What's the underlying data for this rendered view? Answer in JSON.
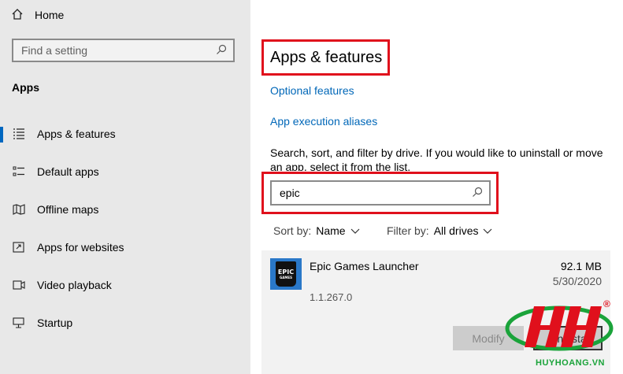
{
  "sidebar": {
    "home_label": "Home",
    "search_placeholder": "Find a setting",
    "section_title": "Apps",
    "items": [
      {
        "label": "Apps & features",
        "icon": "apps-features-icon",
        "active": true
      },
      {
        "label": "Default apps",
        "icon": "default-apps-icon"
      },
      {
        "label": "Offline maps",
        "icon": "map-icon"
      },
      {
        "label": "Apps for websites",
        "icon": "apps-websites-icon"
      },
      {
        "label": "Video playback",
        "icon": "video-icon"
      },
      {
        "label": "Startup",
        "icon": "startup-icon"
      }
    ]
  },
  "main": {
    "title": "Apps & features",
    "links": [
      "Optional features",
      "App execution aliases"
    ],
    "description": "Search, sort, and filter by drive. If you would like to uninstall or move an app, select it from the list.",
    "search_value": "epic",
    "sort_label": "Sort by:",
    "sort_value": "Name",
    "filter_label": "Filter by:",
    "filter_value": "All drives",
    "app": {
      "name": "Epic Games Launcher",
      "size": "92.1 MB",
      "date": "5/30/2020",
      "version": "1.1.267.0",
      "logo_text_top": "EPIC",
      "logo_text_bottom": "GAMES",
      "modify_label": "Modify",
      "uninstall_label": "Uninsta"
    }
  },
  "watermark": {
    "text": "HUYHOANG.VN",
    "mark": "®"
  },
  "colors": {
    "accent": "#0067c0",
    "link": "#0067b8",
    "highlight": "#e0101c",
    "sidebar_bg": "#e8e8e8",
    "watermark_red": "#e0101c",
    "watermark_green": "#1aa33a"
  }
}
